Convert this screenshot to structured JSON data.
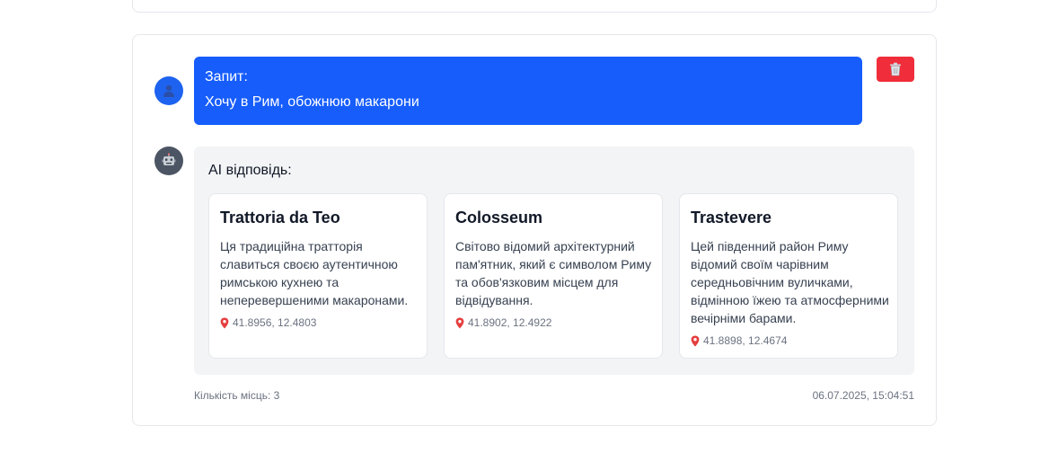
{
  "colors": {
    "query_bubble": "#165dfc",
    "delete_button": "#f02d3a",
    "answer_background": "#f3f4f6",
    "user_avatar": "#1e63f0",
    "ai_avatar": "#4b5563"
  },
  "icons": {
    "user_avatar": "user-icon",
    "ai_avatar": "robot-icon",
    "delete": "trash-icon",
    "location": "pin-icon"
  },
  "query": {
    "label": "Запит:",
    "text": "Хочу в Рим, обожнюю макарони"
  },
  "answer": {
    "label": "AI відповідь:",
    "places": [
      {
        "title": "Trattoria da Teo",
        "description": "Ця традиційна тратторія славиться своєю аутентичною римською кухнею та неперевершеними макаронами.",
        "coords": "41.8956, 12.4803"
      },
      {
        "title": "Colosseum",
        "description": "Світово відомий архітектурний пам'ятник, який є символом Риму та обов'язковим місцем для відвідування.",
        "coords": "41.8902, 12.4922"
      },
      {
        "title": "Trastevere",
        "description": "Цей південний район Риму відомий своїм чарівним середньовічним вуличками, відмінною їжею та атмосферними вечірніми барами.",
        "coords": "41.8898, 12.4674"
      }
    ]
  },
  "footer": {
    "count": "Кількість місць: 3",
    "timestamp": "06.07.2025, 15:04:51"
  }
}
